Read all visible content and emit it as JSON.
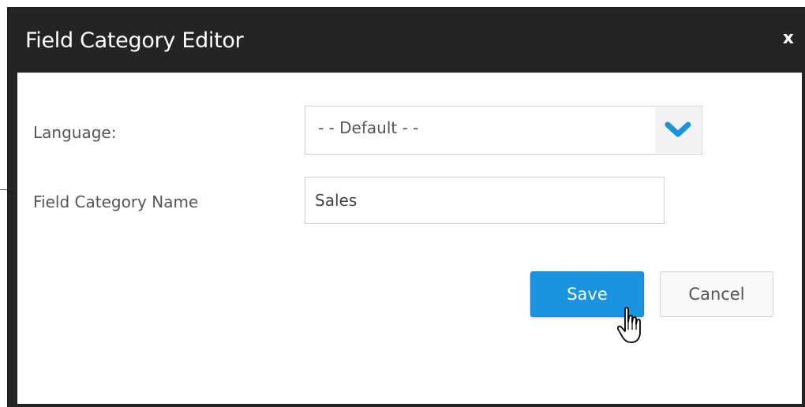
{
  "dialog": {
    "title": "Field Category Editor",
    "close_label": "x"
  },
  "language": {
    "label": "Language:",
    "selected_value": "- - Default - -",
    "dropdown_icon": "chevron-down-icon",
    "accent_color": "#1a93e0"
  },
  "category_name": {
    "label": "Field Category Name",
    "value": "Sales"
  },
  "actions": {
    "save_label": "Save",
    "cancel_label": "Cancel"
  },
  "cursor": {
    "icon": "hand-pointer-icon"
  }
}
